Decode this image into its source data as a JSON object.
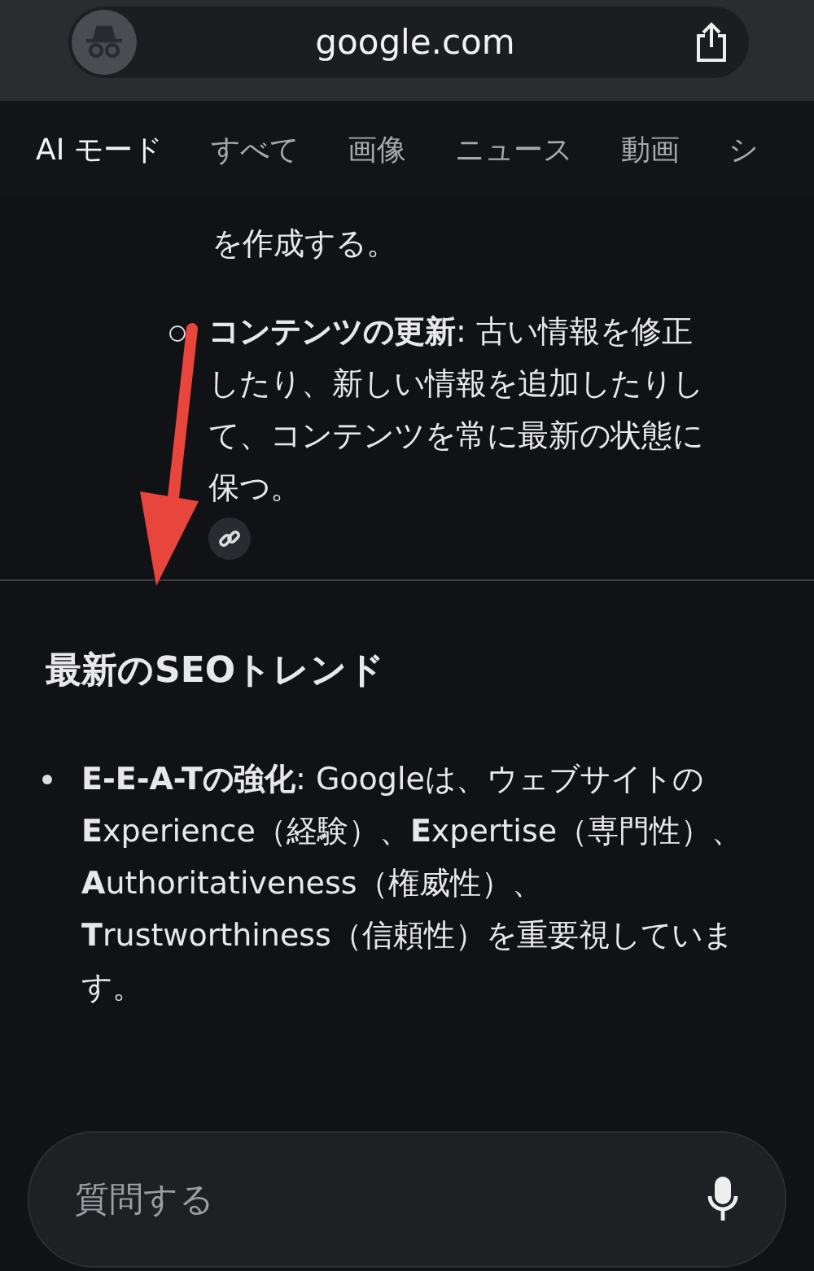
{
  "address_bar": {
    "url": "google.com"
  },
  "tabs": [
    {
      "label": "AI モード",
      "selected": true
    },
    {
      "label": "すべて",
      "selected": false
    },
    {
      "label": "画像",
      "selected": false
    },
    {
      "label": "ニュース",
      "selected": false
    },
    {
      "label": "動画",
      "selected": false
    },
    {
      "label": "シ",
      "selected": false
    }
  ],
  "answer": {
    "fragment": "を作成する。",
    "sub_bullet": "**コンテンツの更新**: 古い情報を修正したり、新しい情報を追加したりして、コンテンツを常に最新の状態に保つ。",
    "heading": "最新のSEOトレンド",
    "bullet": "**E-E-A-Tの強化**: Googleは、ウェブサイトの**E**xperience（経験）、**E**xpertise（専門性）、**A**uthoritativeness（権威性）、**T**rustworthiness（信頼性）を重要視しています。"
  },
  "ask_field": {
    "placeholder": "質問する"
  }
}
